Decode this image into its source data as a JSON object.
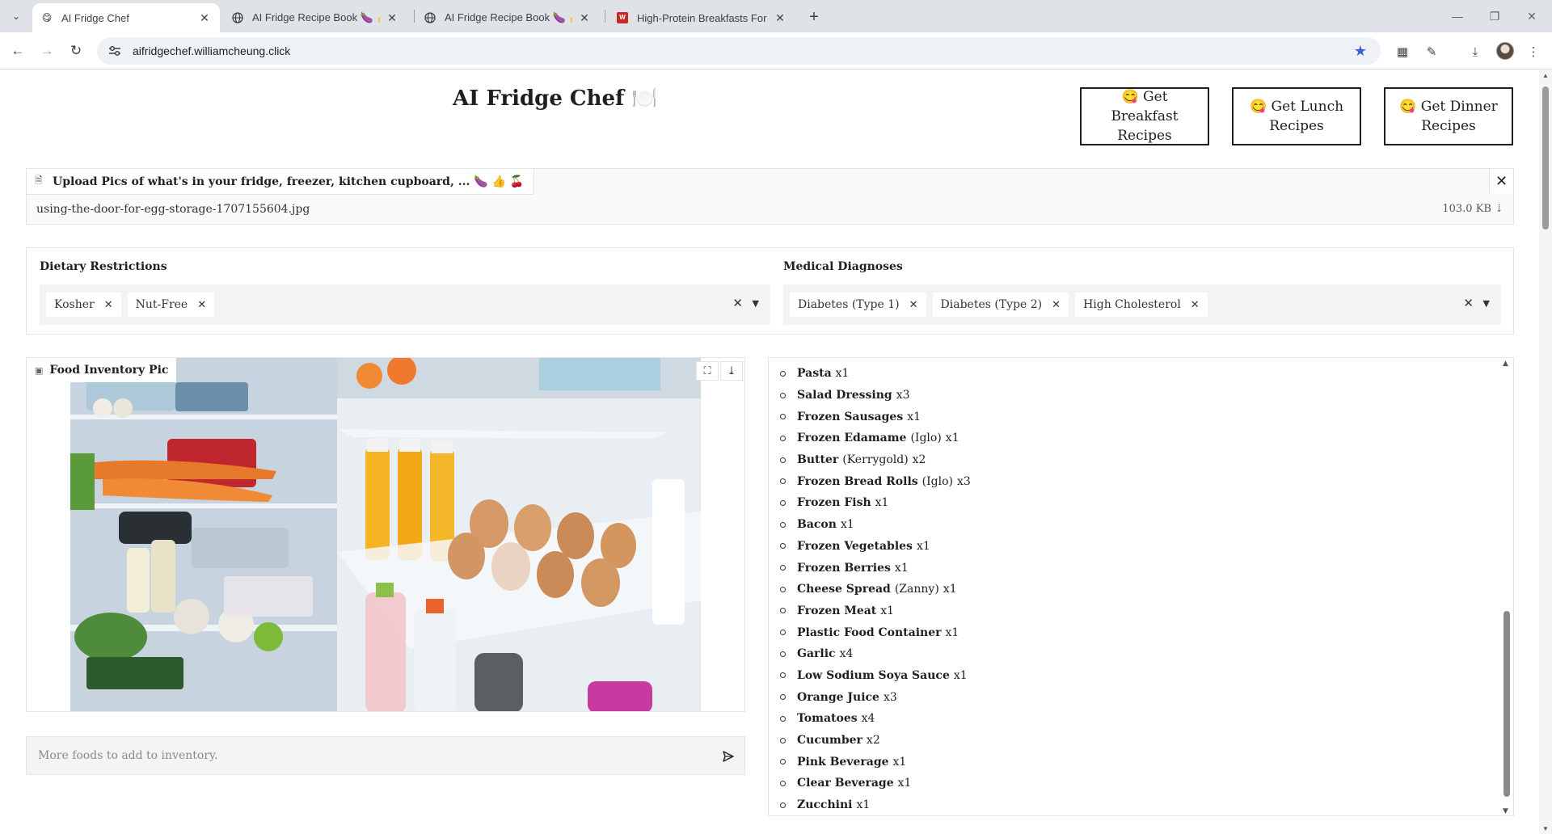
{
  "browser": {
    "tabs": [
      {
        "title": "AI Fridge Chef",
        "favicon": "smile-face-icon",
        "active": true
      },
      {
        "title": "AI Fridge Recipe Book 🍆 👍 🍒",
        "favicon": "globe-icon",
        "active": false
      },
      {
        "title": "AI Fridge Recipe Book 🍆 👍 🍒",
        "favicon": "globe-icon",
        "active": false
      },
      {
        "title": "High-Protein Breakfasts For We",
        "favicon": "wl-logo-icon",
        "active": false
      }
    ],
    "url": "aifridgechef.williamcheung.click",
    "accent_color": "#3b5bdb"
  },
  "header": {
    "title": "AI Fridge Chef",
    "title_icon": "🍽️",
    "buttons": [
      {
        "emoji": "😋",
        "label": "Get Breakfast Recipes"
      },
      {
        "emoji": "😋",
        "label": "Get Lunch Recipes"
      },
      {
        "emoji": "😋",
        "label": "Get Dinner Recipes"
      }
    ]
  },
  "upload": {
    "label": "Upload Pics of what's in your fridge, freezer, kitchen cupboard, ... 🍆 👍 🍒",
    "file_name": "using-the-door-for-egg-storage-1707155604.jpg",
    "file_size": "103.0 KB ⇣"
  },
  "dietary": {
    "label": "Dietary Restrictions",
    "selected": [
      "Kosher",
      "Nut-Free"
    ]
  },
  "medical": {
    "label": "Medical Diagnoses",
    "selected": [
      "Diabetes (Type 1)",
      "Diabetes (Type 2)",
      "High Cholesterol"
    ]
  },
  "image_panel": {
    "label": "Food Inventory Pic"
  },
  "more_foods": {
    "placeholder": "More foods to add to inventory."
  },
  "inventory": [
    {
      "name": "Pasta",
      "brand": "",
      "qty": "x1"
    },
    {
      "name": "Salad Dressing",
      "brand": "",
      "qty": "x3"
    },
    {
      "name": "Frozen Sausages",
      "brand": "",
      "qty": "x1"
    },
    {
      "name": "Frozen Edamame",
      "brand": "(Iglo)",
      "qty": "x1"
    },
    {
      "name": "Butter",
      "brand": "(Kerrygold)",
      "qty": "x2"
    },
    {
      "name": "Frozen Bread Rolls",
      "brand": "(Iglo)",
      "qty": "x3"
    },
    {
      "name": "Frozen Fish",
      "brand": "",
      "qty": "x1"
    },
    {
      "name": "Bacon",
      "brand": "",
      "qty": "x1"
    },
    {
      "name": "Frozen Vegetables",
      "brand": "",
      "qty": "x1"
    },
    {
      "name": "Frozen Berries",
      "brand": "",
      "qty": "x1"
    },
    {
      "name": "Cheese Spread",
      "brand": "(Zanny)",
      "qty": "x1"
    },
    {
      "name": "Frozen Meat",
      "brand": "",
      "qty": "x1"
    },
    {
      "name": "Plastic Food Container",
      "brand": "",
      "qty": "x1"
    },
    {
      "name": "Garlic",
      "brand": "",
      "qty": "x4"
    },
    {
      "name": "Low Sodium Soya Sauce",
      "brand": "",
      "qty": "x1"
    },
    {
      "name": "Orange Juice",
      "brand": "",
      "qty": "x3"
    },
    {
      "name": "Tomatoes",
      "brand": "",
      "qty": "x4"
    },
    {
      "name": "Cucumber",
      "brand": "",
      "qty": "x2"
    },
    {
      "name": "Pink Beverage",
      "brand": "",
      "qty": "x1"
    },
    {
      "name": "Clear Beverage",
      "brand": "",
      "qty": "x1"
    },
    {
      "name": "Zucchini",
      "brand": "",
      "qty": "x1"
    }
  ]
}
